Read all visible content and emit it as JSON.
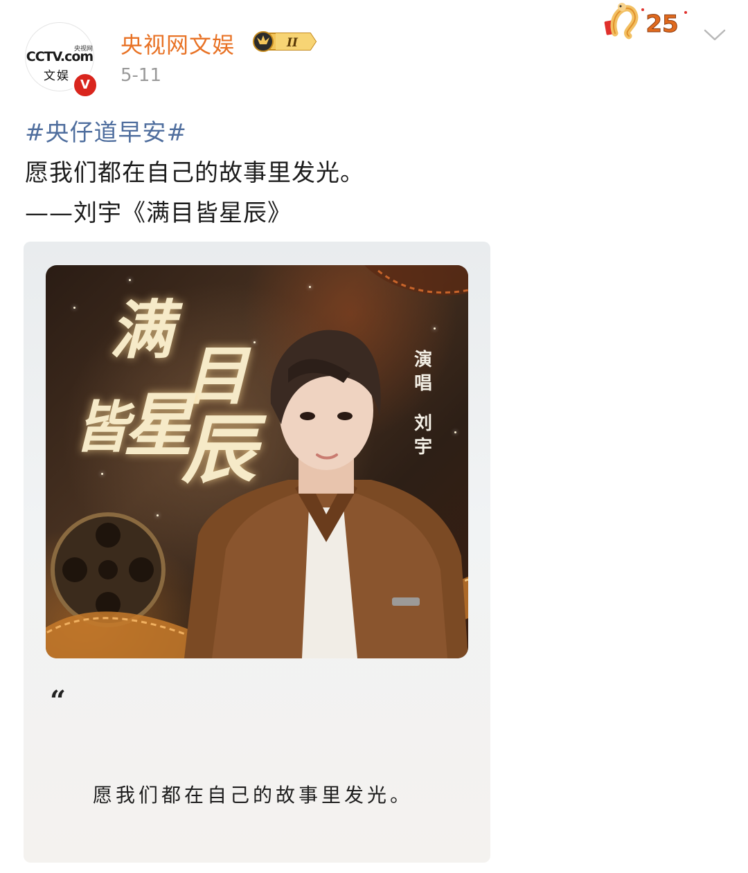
{
  "post": {
    "author": {
      "name": "央视网文娱",
      "avatar_logo": "CCTV.com",
      "avatar_logo_sub": "央视网",
      "avatar_logo_line2": "文娱",
      "verified_mark": "V",
      "level_badge": "II"
    },
    "date": "5-11",
    "hashtag": "#央仔道早安#",
    "text_lines": [
      "愿我们都在自己的故事里发光。",
      "——刘宇《满目皆星辰》"
    ]
  },
  "decoration": {
    "number": "25"
  },
  "card": {
    "cover": {
      "title_chars": [
        "满",
        "目",
        "皆",
        "星",
        "辰"
      ],
      "credit_lines": [
        "演",
        "唱",
        "刘",
        "宇"
      ]
    },
    "quote_mark": "“",
    "quote_text": "愿我们都在自己的故事里发光。"
  },
  "colors": {
    "username": "#e87225",
    "hashtag": "#4f6e9e",
    "verified": "#d9251d",
    "date": "#999999"
  }
}
